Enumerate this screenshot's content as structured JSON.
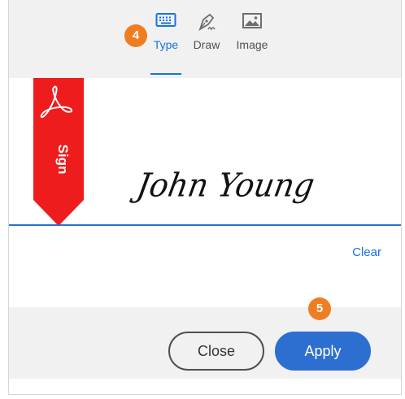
{
  "tabs": [
    {
      "label": "Type",
      "icon": "keyboard-icon",
      "active": true
    },
    {
      "label": "Draw",
      "icon": "pen-icon",
      "active": false
    },
    {
      "label": "Image",
      "icon": "image-icon",
      "active": false
    }
  ],
  "steps": {
    "tab_step": "4",
    "apply_step": "5"
  },
  "ribbon": {
    "label": "Sign",
    "icon": "acrobat-logo-icon",
    "color": "#ee1c1c"
  },
  "signature": {
    "text": "John Young"
  },
  "clear_label": "Clear",
  "buttons": {
    "close_label": "Close",
    "apply_label": "Apply"
  },
  "colors": {
    "accent": "#1473e6",
    "primary_button": "#2d6fd1",
    "step_badge": "#ef7d22"
  }
}
